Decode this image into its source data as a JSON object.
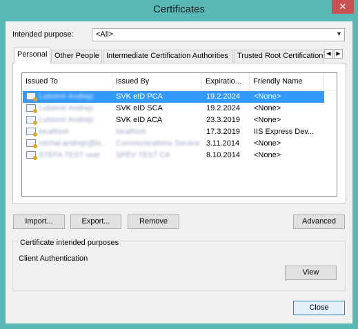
{
  "window": {
    "title": "Certificates",
    "close_glyph": "✕"
  },
  "intended_purpose": {
    "label": "Intended purpose:",
    "value": "<All>"
  },
  "tabs": [
    {
      "label": "Personal"
    },
    {
      "label": "Other People"
    },
    {
      "label": "Intermediate Certification Authorities"
    },
    {
      "label": "Trusted Root Certification Authorities"
    }
  ],
  "tab_scroll": {
    "left": "◀",
    "right": "▶"
  },
  "columns": [
    "Issued To",
    "Issued By",
    "Expiratio...",
    "Friendly Name"
  ],
  "rows": [
    {
      "issued_to": "Ľubomír Andrejc",
      "issued_by": "SVK eID PCA",
      "expiration": "19.2.2024",
      "friendly": "<None>",
      "selected": true
    },
    {
      "issued_to": "Ľubomír Andrejc",
      "issued_by": "SVK eID SCA",
      "expiration": "19.2.2024",
      "friendly": "<None>"
    },
    {
      "issued_to": "Ľubomír Andrejc",
      "issued_by": "SVK eID ACA",
      "expiration": "23.3.2019",
      "friendly": "<None>"
    },
    {
      "issued_to": "localhost",
      "issued_by": "localhost",
      "expiration": "17.3.2019",
      "friendly": "IIS Express Dev..."
    },
    {
      "issued_to": "michal.andrejc@lo...",
      "issued_by": "Communications Service",
      "expiration": "3.11.2014",
      "friendly": "<None>"
    },
    {
      "issued_to": "ŠTEFA TEST user",
      "issued_by": "SPEV TEST CA",
      "expiration": "8.10.2014",
      "friendly": "<None>"
    }
  ],
  "buttons": {
    "import": "Import...",
    "export": "Export...",
    "remove": "Remove",
    "advanced": "Advanced",
    "view": "View",
    "close": "Close"
  },
  "purposes": {
    "title": "Certificate intended purposes",
    "value": "Client Authentication"
  }
}
